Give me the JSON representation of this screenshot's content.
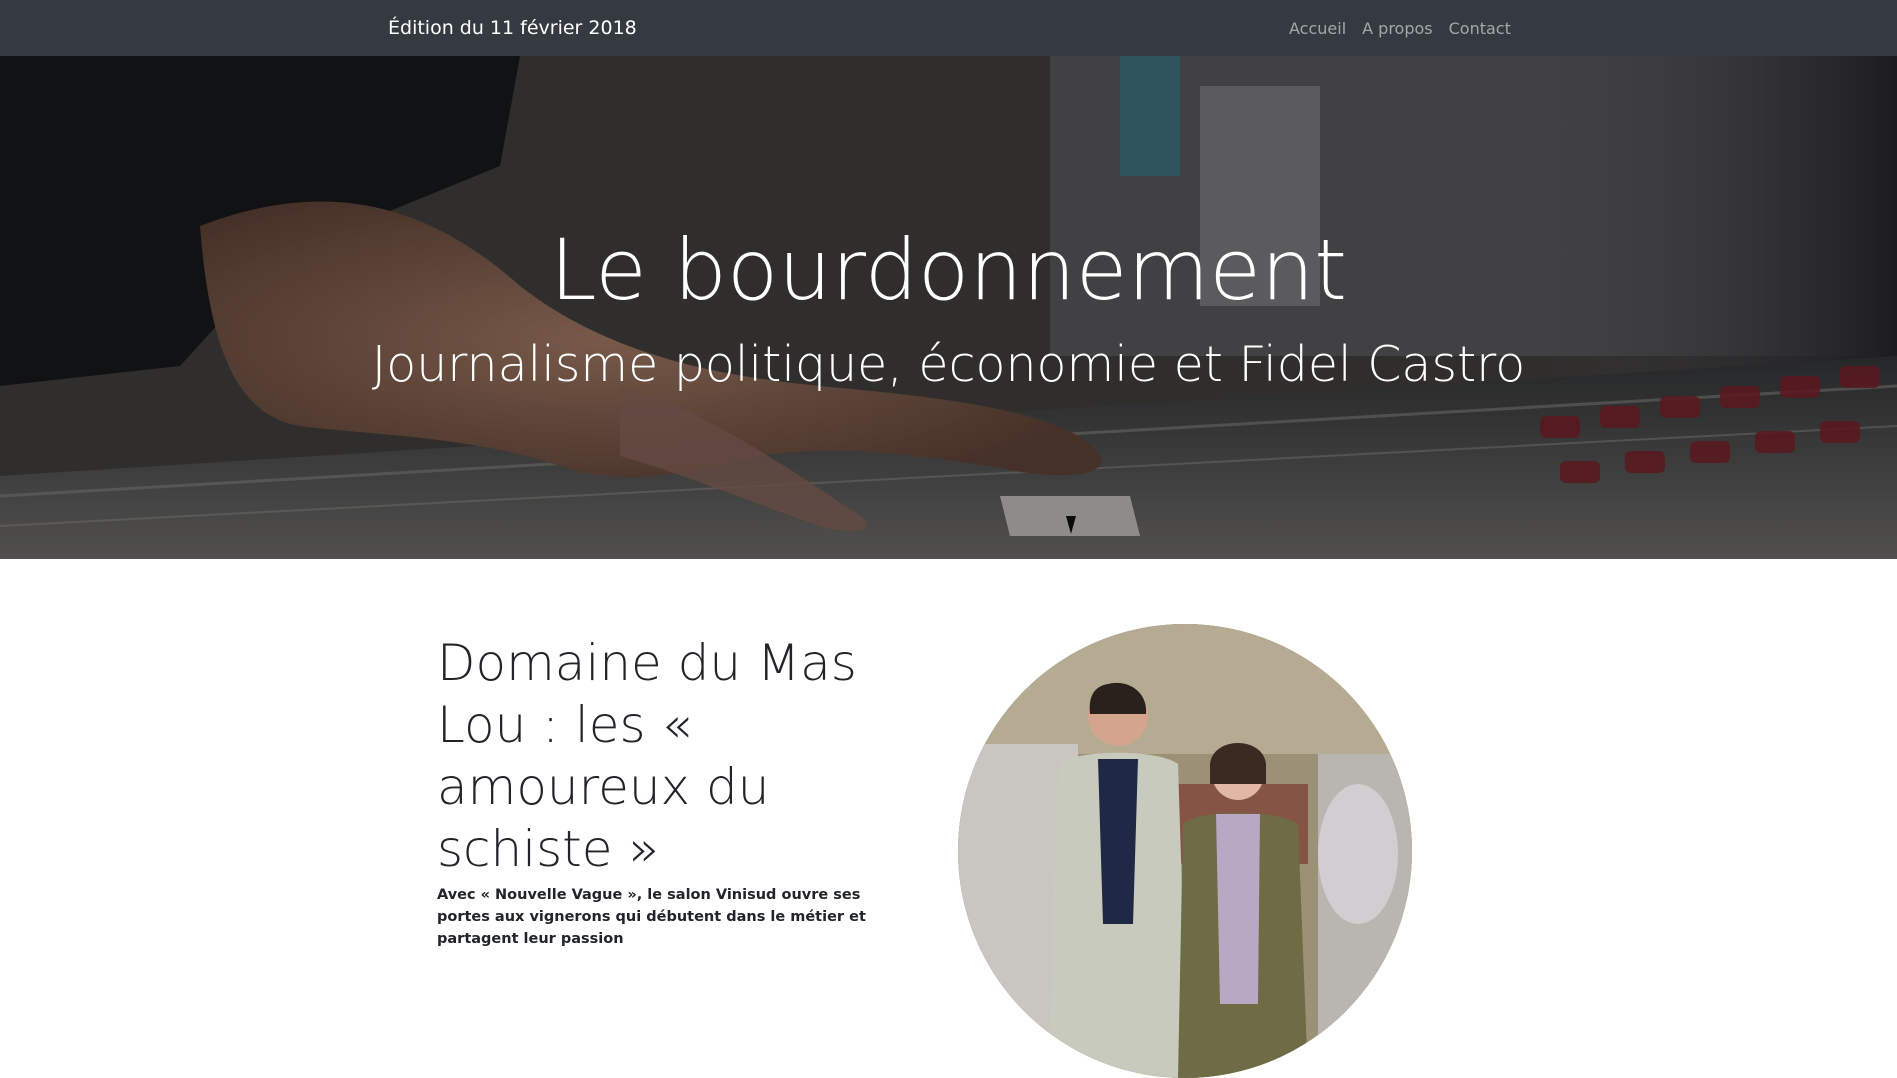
{
  "navbar": {
    "brand": "Édition du 11 février 2018",
    "links": [
      {
        "label": "Accueil"
      },
      {
        "label": "A propos"
      },
      {
        "label": "Contact"
      }
    ]
  },
  "hero": {
    "title": "Le bourdonnement",
    "subtitle": "Journalisme politique, économie et Fidel Castro"
  },
  "article": {
    "title": "Domaine du Mas Lou : les « amoureux du schiste »",
    "lead": "Avec « Nouvelle Vague », le salon Vinisud ouvre ses portes aux vignerons qui débutent dans le métier et partagent leur passion"
  }
}
